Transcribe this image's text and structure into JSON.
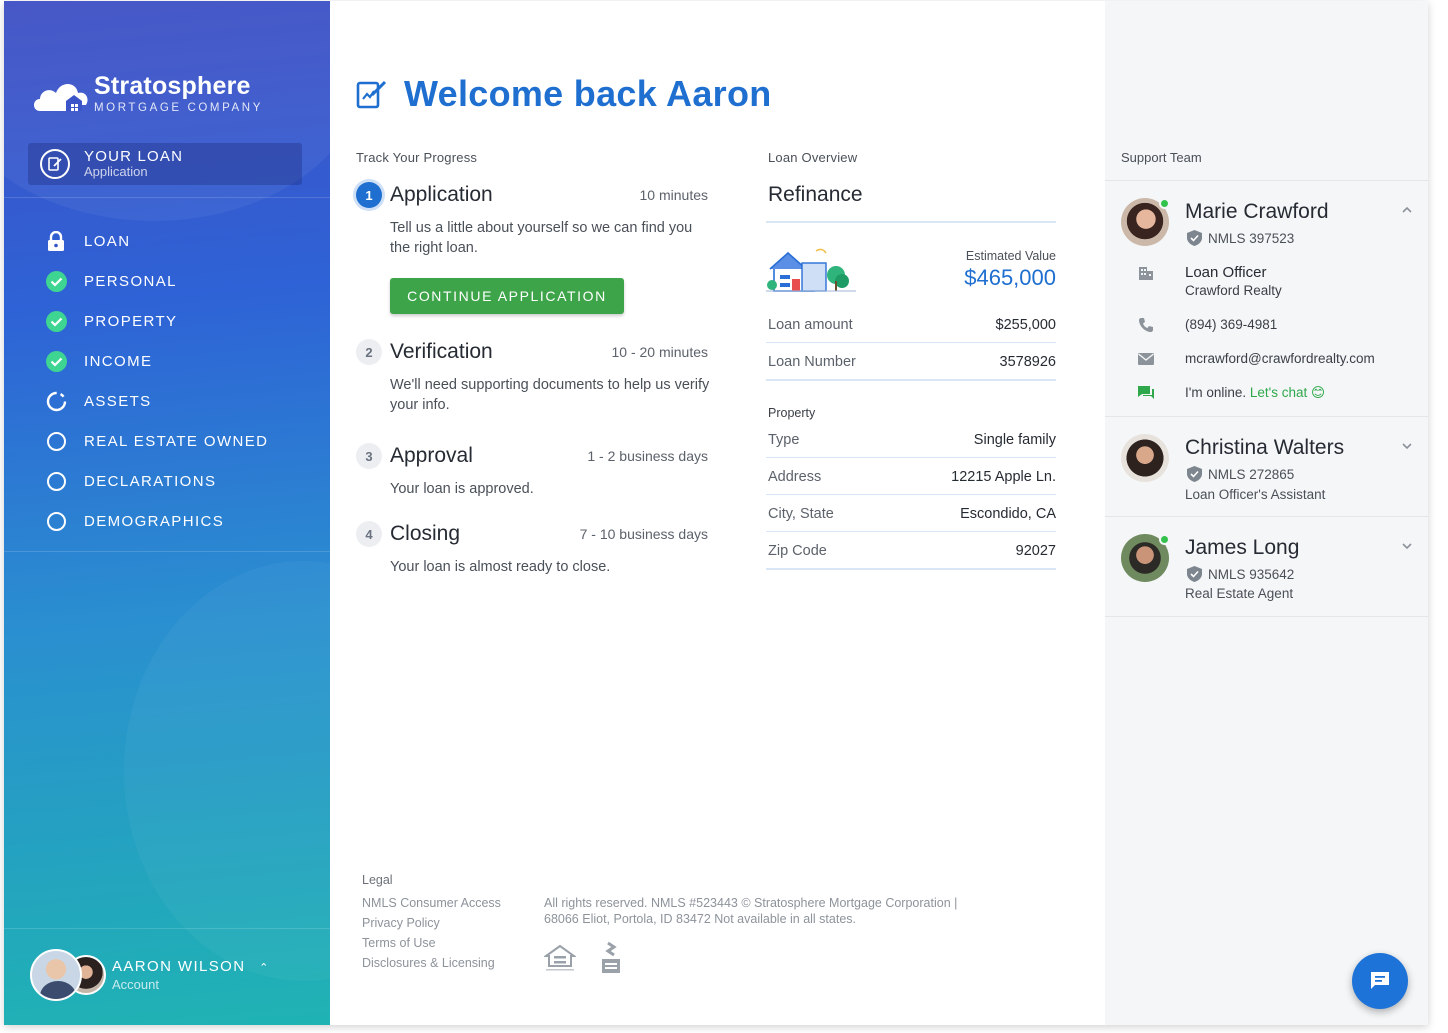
{
  "brand": {
    "name": "Stratosphere",
    "sub": "MORTGAGE COMPANY"
  },
  "your_loan": {
    "title": "YOUR LOAN",
    "sub": "Application"
  },
  "nav": [
    {
      "label": "LOAN",
      "icon": "lock-icon",
      "status": "current"
    },
    {
      "label": "PERSONAL",
      "icon": "check-circle-icon",
      "status": "complete"
    },
    {
      "label": "PROPERTY",
      "icon": "check-circle-icon",
      "status": "complete"
    },
    {
      "label": "INCOME",
      "icon": "check-circle-icon",
      "status": "complete"
    },
    {
      "label": "ASSETS",
      "icon": "progress-circle-icon",
      "status": "in-progress"
    },
    {
      "label": "REAL ESTATE OWNED",
      "icon": "empty-circle-icon",
      "status": "pending"
    },
    {
      "label": "DECLARATIONS",
      "icon": "empty-circle-icon",
      "status": "pending"
    },
    {
      "label": "DEMOGRAPHICS",
      "icon": "empty-circle-icon",
      "status": "pending"
    }
  ],
  "account": {
    "name": "AARON WILSON",
    "sub": "Account"
  },
  "welcome": "Welcome back Aaron",
  "progress": {
    "label": "Track Your Progress",
    "steps": [
      {
        "num": "1",
        "title": "Application",
        "time": "10 minutes",
        "desc": "Tell us a little about yourself so we can find you the right loan."
      },
      {
        "num": "2",
        "title": "Verification",
        "time": "10 - 20 minutes",
        "desc": "We'll need supporting documents to help us verify your info."
      },
      {
        "num": "3",
        "title": "Approval",
        "time": "1 - 2 business days",
        "desc": "Your loan is approved."
      },
      {
        "num": "4",
        "title": "Closing",
        "time": "7 - 10 business days",
        "desc": "Your loan is almost ready to close."
      }
    ],
    "continue_label": "CONTINUE APPLICATION"
  },
  "overview": {
    "label": "Loan Overview",
    "title": "Refinance",
    "estimated_label": "Estimated Value",
    "estimated_value": "$465,000",
    "rows": [
      {
        "k": "Loan amount",
        "v": "$255,000"
      },
      {
        "k": "Loan Number",
        "v": "3578926"
      }
    ],
    "property_label": "Property",
    "property_rows": [
      {
        "k": "Type",
        "v": "Single family"
      },
      {
        "k": "Address",
        "v": "12215 Apple Ln."
      },
      {
        "k": "City, State",
        "v": "Escondido, CA"
      },
      {
        "k": "Zip Code",
        "v": "92027"
      }
    ]
  },
  "footer": {
    "legal_head": "Legal",
    "links": [
      "NMLS Consumer Access",
      "Privacy Policy",
      "Terms of Use",
      "Disclosures & Licensing"
    ],
    "copyright": "All rights reserved. NMLS #523443 © Stratosphere Mortgage Corporation | 68066 Eliot, Portola, ID 83472 Not available in all states."
  },
  "support": {
    "label": "Support Team",
    "members": [
      {
        "name": "Marie Crawford",
        "nmls": "NMLS 397523",
        "online": true
      },
      {
        "name": "Christina Walters",
        "nmls": "NMLS 272865",
        "role": "Loan Officer's Assistant",
        "online": false
      },
      {
        "name": "James Long",
        "nmls": "NMLS 935642",
        "role": "Real Estate Agent",
        "online": true
      }
    ],
    "marie_contact": {
      "role": "Loan Officer",
      "company": "Crawford Realty",
      "phone": "(894) 369-4981",
      "email": "mcrawford@crawfordrealty.com",
      "online_text": "I'm online. ",
      "chat_link": "Let's chat 😊"
    }
  },
  "colors": {
    "accent": "#1e6fd0",
    "success": "#3ea44a",
    "online": "#33c24d"
  }
}
